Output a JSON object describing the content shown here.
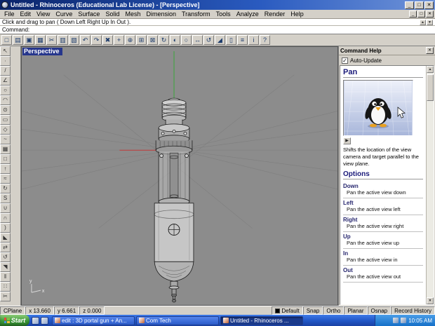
{
  "window": {
    "title": "Untitled - Rhinoceros (Educational Lab License) - [Perspective]",
    "buttons": [
      {
        "name": "minimize-button",
        "glyph": "_"
      },
      {
        "name": "maximize-button",
        "glyph": "□"
      },
      {
        "name": "close-button",
        "glyph": "✕"
      }
    ]
  },
  "menu": {
    "items": [
      "File",
      "Edit",
      "View",
      "Curve",
      "Surface",
      "Solid",
      "Mesh",
      "Dimension",
      "Transform",
      "Tools",
      "Analyze",
      "Render",
      "Help"
    ],
    "child_buttons": [
      {
        "name": "child-minimize-button",
        "glyph": "_"
      },
      {
        "name": "child-restore-button",
        "glyph": "□"
      },
      {
        "name": "child-close-button",
        "glyph": "✕"
      }
    ]
  },
  "command": {
    "history": "Click and drag to pan ( Down  Left  Right  Up  In  Out ).",
    "prompt": "Command:",
    "nav": [
      {
        "name": "history-scroll-up-button",
        "glyph": "▲"
      },
      {
        "name": "history-scroll-down-button",
        "glyph": "▼"
      }
    ]
  },
  "toolbar": {
    "icons": [
      {
        "name": "new-file-icon",
        "glyph": "□"
      },
      {
        "name": "open-file-icon",
        "glyph": "▤"
      },
      {
        "name": "save-icon",
        "glyph": "▣"
      },
      {
        "name": "print-icon",
        "glyph": "▦"
      },
      {
        "name": "cut-icon",
        "glyph": "✂"
      },
      {
        "name": "copy-icon",
        "glyph": "▥"
      },
      {
        "name": "paste-icon",
        "glyph": "▧"
      },
      {
        "name": "undo-icon",
        "glyph": "↶"
      },
      {
        "name": "redo-icon",
        "glyph": "↷"
      },
      {
        "name": "delete-icon",
        "glyph": "✖"
      },
      {
        "name": "pan-view-icon",
        "glyph": "+"
      },
      {
        "name": "zoom-dynamic-icon",
        "glyph": "⊕"
      },
      {
        "name": "zoom-window-icon",
        "glyph": "⊞"
      },
      {
        "name": "zoom-extents-icon",
        "glyph": "⊠"
      },
      {
        "name": "rotate-view-icon",
        "glyph": "↻"
      },
      {
        "name": "shade-view-icon",
        "glyph": "◐"
      },
      {
        "name": "wireframe-view-icon",
        "glyph": "○"
      },
      {
        "name": "move-icon",
        "glyph": "↔"
      },
      {
        "name": "rotate-object-icon",
        "glyph": "↺"
      },
      {
        "name": "scale-object-icon",
        "glyph": "◢"
      },
      {
        "name": "mirror-icon",
        "glyph": "▯"
      },
      {
        "name": "layers-icon",
        "glyph": "≡"
      },
      {
        "name": "properties-icon",
        "glyph": "i"
      },
      {
        "name": "help-icon",
        "glyph": "?"
      }
    ]
  },
  "side_toolbar": {
    "icons": [
      {
        "name": "select-pointer-icon",
        "glyph": "↖"
      },
      {
        "name": "point-icon",
        "glyph": "∙"
      },
      {
        "name": "line-icon",
        "glyph": "/"
      },
      {
        "name": "polyline-icon",
        "glyph": "∠"
      },
      {
        "name": "circle-icon",
        "glyph": "○"
      },
      {
        "name": "arc-icon",
        "glyph": "◠"
      },
      {
        "name": "ellipse-icon",
        "glyph": "⊙"
      },
      {
        "name": "rectangle-icon",
        "glyph": "▭"
      },
      {
        "name": "polygon-icon",
        "glyph": "◇"
      },
      {
        "name": "freeform-curve-icon",
        "glyph": "~"
      },
      {
        "name": "surface-icon",
        "glyph": "▦"
      },
      {
        "name": "plane-icon",
        "glyph": "□"
      },
      {
        "name": "extrude-icon",
        "glyph": "↑"
      },
      {
        "name": "loft-icon",
        "glyph": "≈"
      },
      {
        "name": "revolve-icon",
        "glyph": "↻"
      },
      {
        "name": "sweep-icon",
        "glyph": "S"
      },
      {
        "name": "boolean-union-icon",
        "glyph": "∪"
      },
      {
        "name": "boolean-difference-icon",
        "glyph": "∩"
      },
      {
        "name": "fillet-icon",
        "glyph": ")"
      },
      {
        "name": "chamfer-icon",
        "glyph": "◣"
      },
      {
        "name": "move-object-icon",
        "glyph": "⇄"
      },
      {
        "name": "rotate-icon",
        "glyph": "↺"
      },
      {
        "name": "scale-icon",
        "glyph": "◥"
      },
      {
        "name": "mirror-object-icon",
        "glyph": "‖"
      },
      {
        "name": "array-icon",
        "glyph": "∷"
      },
      {
        "name": "trim-icon",
        "glyph": "✂"
      }
    ]
  },
  "viewport": {
    "label": "Perspective",
    "axis_x": "x",
    "axis_y": "y"
  },
  "help_panel": {
    "title": "Command Help",
    "auto_update": "Auto-Update",
    "checkbox_glyph": "✓",
    "topic": "Pan",
    "play_glyph": "▶",
    "description": "Shifts the location of the view camera and target parallel to the view plane.",
    "options_heading": "Options",
    "options": [
      {
        "name": "Down",
        "desc": "Pan the active view down"
      },
      {
        "name": "Left",
        "desc": "Pan the active view left"
      },
      {
        "name": "Right",
        "desc": "Pan the active view right"
      },
      {
        "name": "Up",
        "desc": "Pan the active view up"
      },
      {
        "name": "In",
        "desc": "Pan the active view in"
      },
      {
        "name": "Out",
        "desc": "Pan the active view out"
      }
    ],
    "scroll": {
      "up_glyph": "▲",
      "down_glyph": "▼"
    }
  },
  "status_bar": {
    "cplane": "CPlane",
    "x": "x 13.660",
    "y": "y 6.661",
    "z": "z 0.000",
    "layer": "Default",
    "toggles": [
      "Snap",
      "Ortho",
      "Planar",
      "Osnap",
      "Record History"
    ]
  },
  "taskbar": {
    "start": "Start",
    "tasks": [
      {
        "label": "edit : 3D portal gun + An..."
      },
      {
        "label": "Com Tech"
      },
      {
        "label": "Untitled - Rhinoceros ...",
        "active": true
      }
    ],
    "time": "10:05 AM"
  }
}
